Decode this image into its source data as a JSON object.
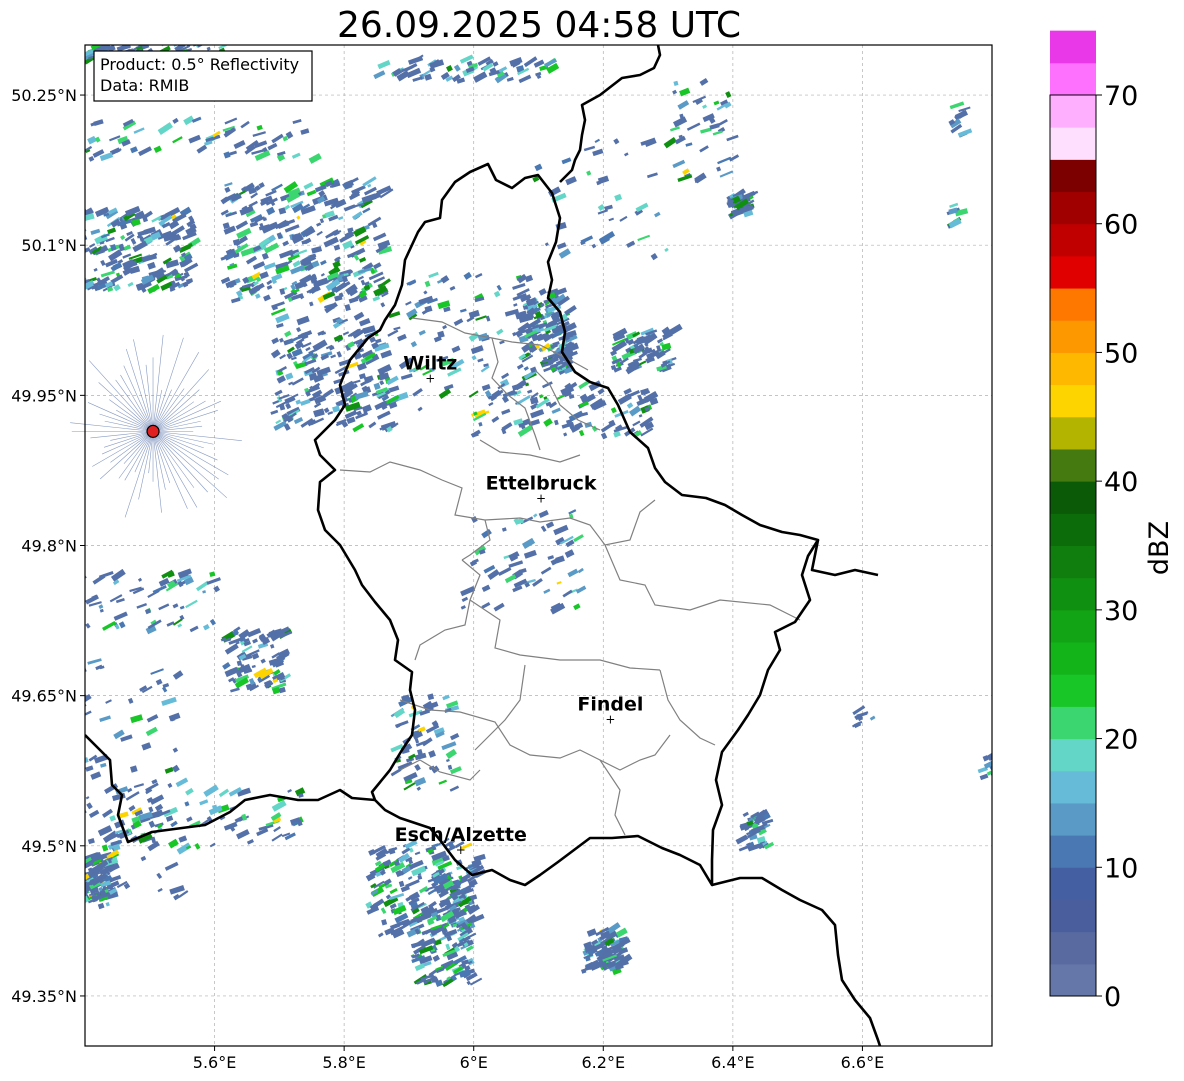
{
  "title": "26.09.2025 04:58 UTC",
  "info_box": {
    "product": "Product: 0.5° Reflectivity",
    "data": "Data: RMIB"
  },
  "map": {
    "lon_range": [
      5.4,
      6.8
    ],
    "lat_range": [
      49.3,
      50.3
    ],
    "lon_ticks": [
      {
        "value": 5.6,
        "label": "5.6°E"
      },
      {
        "value": 5.8,
        "label": "5.8°E"
      },
      {
        "value": 6.0,
        "label": "6°E"
      },
      {
        "value": 6.2,
        "label": "6.2°E"
      },
      {
        "value": 6.4,
        "label": "6.4°E"
      },
      {
        "value": 6.6,
        "label": "6.6°E"
      }
    ],
    "lat_ticks": [
      {
        "value": 50.25,
        "label": "50.25°N"
      },
      {
        "value": 50.1,
        "label": "50.1°N"
      },
      {
        "value": 49.95,
        "label": "49.95°N"
      },
      {
        "value": 49.8,
        "label": "49.8°N"
      },
      {
        "value": 49.65,
        "label": "49.65°N"
      },
      {
        "value": 49.5,
        "label": "49.5°N"
      },
      {
        "value": 49.35,
        "label": "49.35°N"
      }
    ],
    "gridlines": true,
    "radar_site": {
      "lon": 5.505,
      "lat": 49.914
    },
    "cities": [
      {
        "name": "Wiltz",
        "lon": 5.933,
        "lat": 49.967
      },
      {
        "name": "Ettelbruck",
        "lon": 6.104,
        "lat": 49.847
      },
      {
        "name": "Findel",
        "lon": 6.211,
        "lat": 49.626
      },
      {
        "name": "Esch/Alzette",
        "lon": 5.98,
        "lat": 49.496
      }
    ]
  },
  "colorbar": {
    "label": "dBZ",
    "min": 0,
    "max": 70,
    "step": 2.5,
    "ticks": [
      {
        "value": 0,
        "label": "0"
      },
      {
        "value": 10,
        "label": "10"
      },
      {
        "value": 20,
        "label": "20"
      },
      {
        "value": 30,
        "label": "30"
      },
      {
        "value": 40,
        "label": "40"
      },
      {
        "value": 50,
        "label": "50"
      },
      {
        "value": 60,
        "label": "60"
      },
      {
        "value": 70,
        "label": "70"
      }
    ],
    "colors": [
      "#6577a8",
      "#586aa0",
      "#4a5d9c",
      "#4560a2",
      "#4a78b2",
      "#5a9ac6",
      "#66bcd8",
      "#64d6c8",
      "#3cd670",
      "#18c628",
      "#12b41a",
      "#12a414",
      "#109010",
      "#0f7e0e",
      "#0c6c0a",
      "#0a5a08",
      "#447a10",
      "#b2b400",
      "#fed400",
      "#feb800",
      "#fe9800",
      "#fe7800",
      "#e00000",
      "#c00000",
      "#a00000",
      "#7c0000",
      "#fee0fe",
      "#feb0fe",
      "#fe70fe",
      "#e838e8"
    ]
  },
  "reflectivity_style": {
    "dominant_color": "#5470a8",
    "secondary_colors": [
      "#4a78b2",
      "#5a9ac6",
      "#66bcd8",
      "#64d6c8",
      "#3cd670",
      "#18c628",
      "#109010"
    ],
    "highlight_color": "#fed400"
  }
}
